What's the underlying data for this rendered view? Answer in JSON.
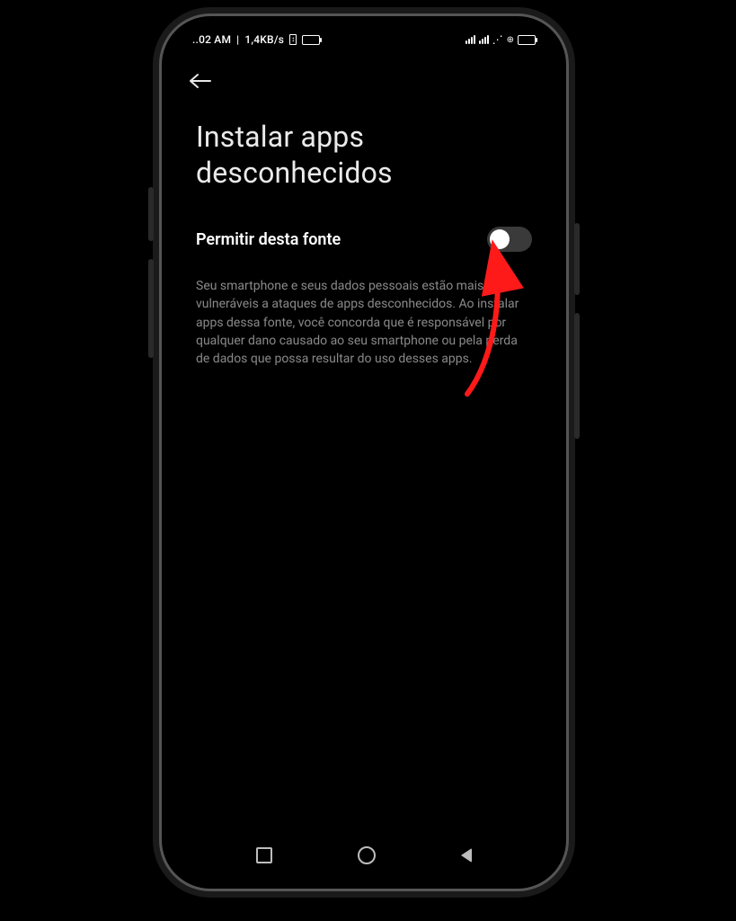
{
  "status_bar": {
    "time": "..02 AM",
    "data_rate": "1,4KB/s"
  },
  "header": {
    "title": "Instalar apps desconhecidos"
  },
  "setting": {
    "label": "Permitir desta fonte",
    "enabled": false
  },
  "description": "Seu smartphone e seus dados pessoais estão mais vulneráveis a ataques de apps desconhecidos. Ao instalar apps dessa fonte, você concorda que é responsável por qualquer dano causado ao seu smartphone ou pela perda de dados que possa resultar do uso desses apps."
}
